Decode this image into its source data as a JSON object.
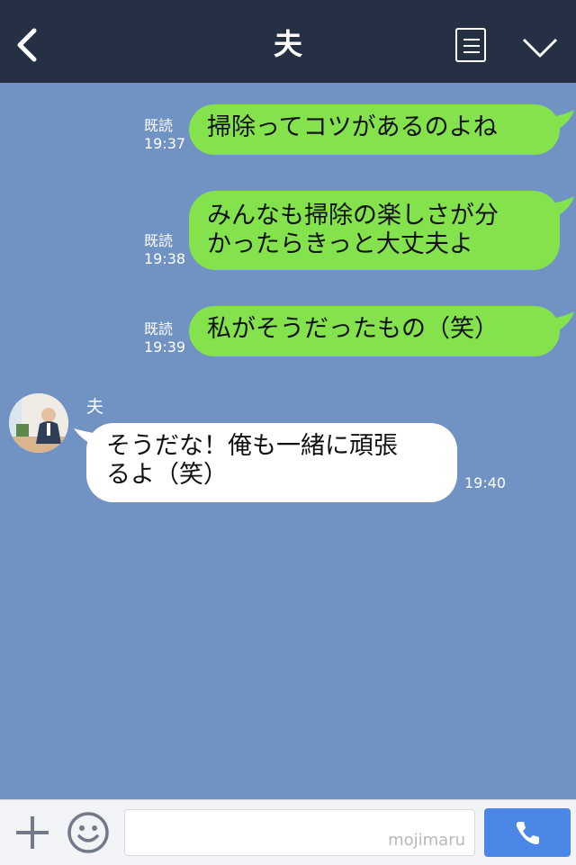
{
  "header": {
    "title": "夫"
  },
  "messages_out": [
    {
      "read_label": "既読",
      "time": "19:37",
      "text": "掃除ってコツがあるのよね"
    },
    {
      "read_label": "既読",
      "time": "19:38",
      "line1": "みんなも掃除の楽しさが分",
      "line2": "かったらきっと大丈夫よ"
    },
    {
      "read_label": "既読",
      "time": "19:39",
      "text": "私がそうだったもの（笑）"
    }
  ],
  "message_in": {
    "sender": "夫",
    "line1": "そうだな！俺も一緒に頑張",
    "line2": "るよ（笑）",
    "time": "19:40"
  },
  "footer": {
    "input_watermark": "mojimaru"
  },
  "colors": {
    "header_bg": "#253044",
    "chat_bg": "#7093c3",
    "outgoing_bubble": "#84e24d",
    "incoming_bubble": "#ffffff",
    "call_button": "#4b87e6"
  }
}
